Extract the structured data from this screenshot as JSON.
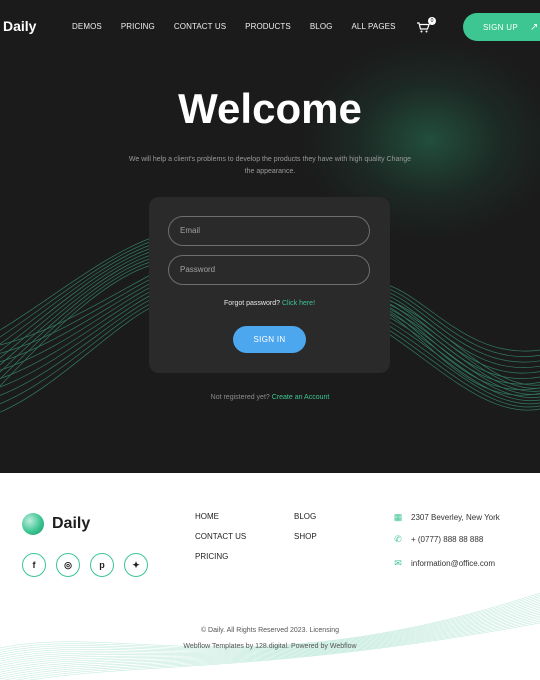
{
  "header": {
    "logo": "Daily",
    "menu": [
      "DEMOS",
      "PRICING",
      "CONTACT US",
      "PRODUCTS",
      "BLOG",
      "ALL PAGES"
    ],
    "cart_count": "0",
    "signup_label": "SIGN UP",
    "signup_arrow": "↗",
    "accent": "#3dc592"
  },
  "hero": {
    "title": "Welcome",
    "subtitle": "We will help a client's problems to develop the products they have with high quality Change the appearance."
  },
  "form": {
    "email_placeholder": "Email",
    "password_placeholder": "Password",
    "forgot_text": "Forgot password?",
    "forgot_link": "Click here!",
    "signin_label": "SIGN IN",
    "signin_color": "#4da7ef",
    "not_registered": "Not registered yet?",
    "create_account": "Create an Account"
  },
  "footer": {
    "brand": "Daily",
    "socials": [
      {
        "icon": "facebook-icon",
        "glyph": "f"
      },
      {
        "icon": "instagram-icon",
        "glyph": "◎"
      },
      {
        "icon": "pinterest-icon",
        "glyph": "p"
      },
      {
        "icon": "twitter-icon",
        "glyph": "✦"
      }
    ],
    "nav_col1": [
      "HOME",
      "CONTACT US",
      "PRICING"
    ],
    "nav_col2": [
      "BLOG",
      "SHOP"
    ],
    "address": "2307 Beverley, New York",
    "phone": "+ (0777) 888 88 888",
    "email": "information@office.com",
    "copyright": "© Daily. All Rights Reserved 2023. Licensing",
    "credits": "Webflow Templates by 128.digital. Powered by Webflow"
  }
}
